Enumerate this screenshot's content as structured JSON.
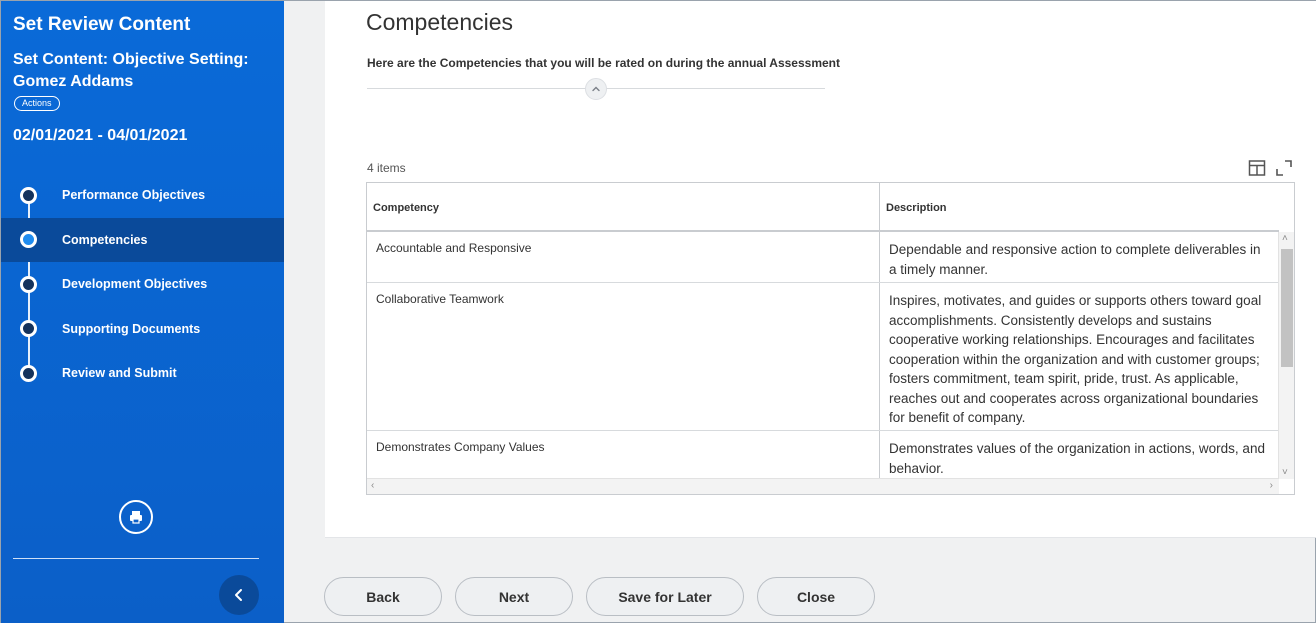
{
  "sidebar": {
    "title": "Set Review Content",
    "subtitle": "Set Content: Objective Setting: Gomez Addams",
    "actions_label": "Actions",
    "dates": "02/01/2021 - 04/01/2021",
    "steps": [
      {
        "label": "Performance Objectives",
        "active": false
      },
      {
        "label": "Competencies",
        "active": true
      },
      {
        "label": "Development Objectives",
        "active": false
      },
      {
        "label": "Supporting Documents",
        "active": false
      },
      {
        "label": "Review and Submit",
        "active": false
      }
    ]
  },
  "main": {
    "title": "Competencies",
    "intro": "Here are the Competencies that you will be rated on during the annual Assessment",
    "items_count": "4 items",
    "columns": [
      "Competency",
      "Description"
    ],
    "rows": [
      {
        "competency": "Accountable and Responsive",
        "description": "Dependable and responsive action to complete deliverables in a timely manner."
      },
      {
        "competency": "Collaborative Teamwork",
        "description": "Inspires, motivates, and guides or supports others toward goal accomplishments. Consistently develops and sustains cooperative working relationships. Encourages and facilitates cooperation within the organization and with customer groups; fosters commitment, team spirit, pride, trust. As applicable, reaches out and cooperates across organizational boundaries for benefit of company."
      },
      {
        "competency": "Demonstrates Company Values",
        "description": "Demonstrates values of the organization in actions, words, and behavior."
      }
    ]
  },
  "footer": {
    "back": "Back",
    "next": "Next",
    "save": "Save for Later",
    "close": "Close"
  },
  "colors": {
    "sidebar_bg": "#0a6ad8",
    "active_step_bg": "#0a4a9a",
    "active_dot": "#1f8cf0"
  }
}
